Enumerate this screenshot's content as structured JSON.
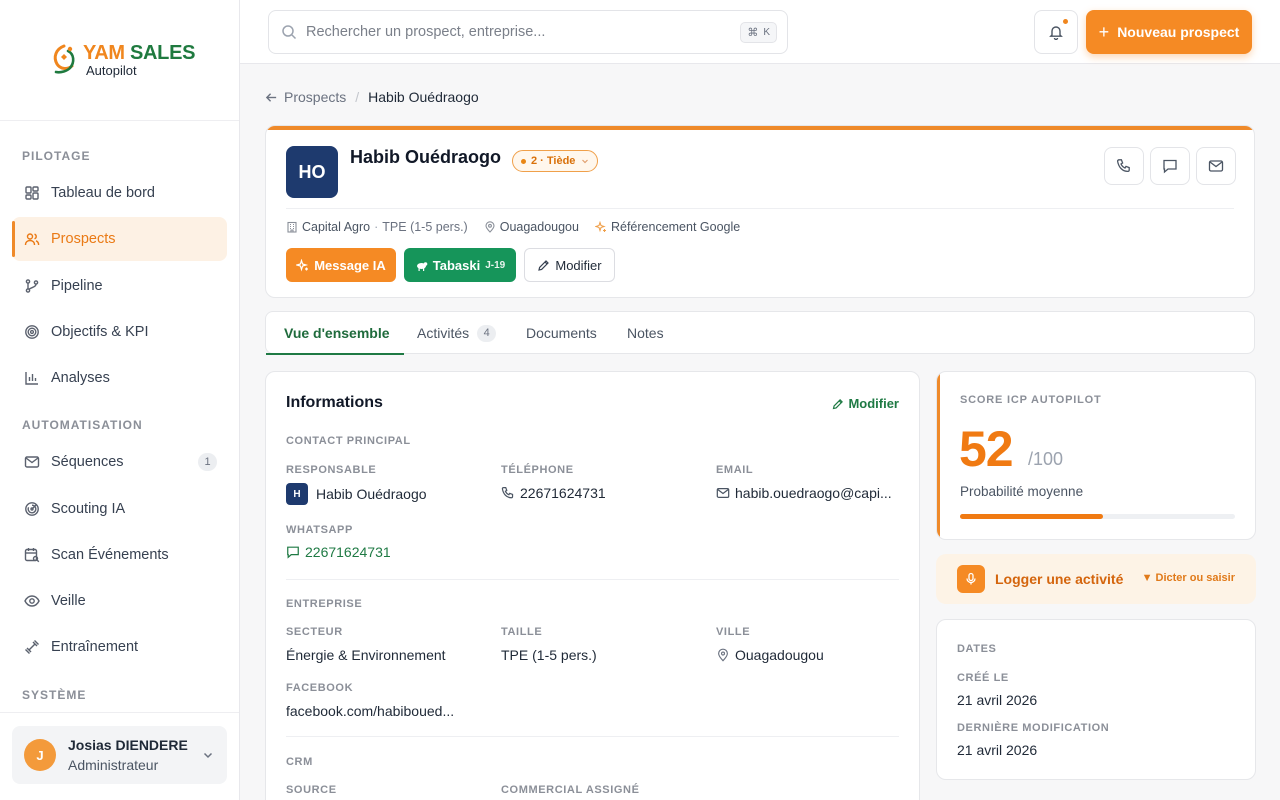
{
  "brand": {
    "name_part1": "YAM",
    "name_part2": "SALES",
    "subtitle": "Autopilot",
    "accent": "#f0861e",
    "green": "#1f7a3f"
  },
  "sidebar": {
    "sections": {
      "pilotage": "PILOTAGE",
      "automatisation": "AUTOMATISATION",
      "systeme": "SYSTÈME"
    },
    "items": [
      {
        "label": "Tableau de bord",
        "icon": "grid-icon"
      },
      {
        "label": "Prospects",
        "icon": "users-icon",
        "active": true
      },
      {
        "label": "Pipeline",
        "icon": "git-branch-icon"
      },
      {
        "label": "Objectifs & KPI",
        "icon": "target-icon"
      },
      {
        "label": "Analyses",
        "icon": "bar-chart-icon"
      },
      {
        "label": "Séquences",
        "icon": "mail-icon",
        "badge": "1"
      },
      {
        "label": "Scouting IA",
        "icon": "radar-icon"
      },
      {
        "label": "Scan Événements",
        "icon": "calendar-search-icon"
      },
      {
        "label": "Veille",
        "icon": "eye-icon"
      },
      {
        "label": "Entraînement",
        "icon": "dumbbell-icon"
      }
    ],
    "user": {
      "initial": "J",
      "name": "Josias DIENDERE",
      "role": "Administrateur"
    }
  },
  "topbar": {
    "search_placeholder": "Rechercher un prospect, entreprise...",
    "shortcut_symbol": "⌘",
    "shortcut_key": "K",
    "new_button": "Nouveau prospect"
  },
  "breadcrumb": {
    "parent": "Prospects",
    "current": "Habib Ouédraogo"
  },
  "prospect": {
    "initials": "HO",
    "name": "Habib Ouédraogo",
    "temperature": "2 · Tiède",
    "company": "Capital Agro",
    "size": "TPE (1-5 pers.)",
    "city": "Ouagadougou",
    "source": "Référencement Google",
    "actions": {
      "ia": "Message IA",
      "tabaski": "Tabaski",
      "tabaski_countdown": "J-19",
      "edit": "Modifier"
    }
  },
  "tabs": [
    {
      "label": "Vue d'ensemble",
      "active": true
    },
    {
      "label": "Activités",
      "count": "4"
    },
    {
      "label": "Documents"
    },
    {
      "label": "Notes"
    }
  ],
  "info": {
    "title": "Informations",
    "edit": "Modifier",
    "contact": {
      "group": "CONTACT PRINCIPAL",
      "responsable_label": "RESPONSABLE",
      "responsable_initial": "H",
      "responsable": "Habib Ouédraogo",
      "phone_label": "TÉLÉPHONE",
      "phone": "22671624731",
      "email_label": "EMAIL",
      "email": "habib.ouedraogo@capi...",
      "whatsapp_label": "WHATSAPP",
      "whatsapp": "22671624731"
    },
    "entreprise": {
      "group": "ENTREPRISE",
      "secteur_label": "SECTEUR",
      "secteur": "Énergie & Environnement",
      "taille_label": "TAILLE",
      "taille": "TPE (1-5 pers.)",
      "ville_label": "VILLE",
      "ville": "Ouagadougou",
      "facebook_label": "FACEBOOK",
      "facebook": "facebook.com/habiboued..."
    },
    "crm": {
      "group": "CRM",
      "source_label": "SOURCE",
      "commercial_label": "COMMERCIAL ASSIGNÉ"
    }
  },
  "score": {
    "label": "SCORE ICP AUTOPILOT",
    "value": "52",
    "max": "/100",
    "probability": "Probabilité moyenne",
    "fraction": 0.52
  },
  "log": {
    "label": "Logger une activité",
    "hint": "▼ Dicter ou saisir"
  },
  "dates": {
    "title": "DATES",
    "created_label": "CRÉÉ LE",
    "created": "21 avril 2026",
    "modified_label": "DERNIÈRE MODIFICATION",
    "modified": "21 avril 2026"
  }
}
